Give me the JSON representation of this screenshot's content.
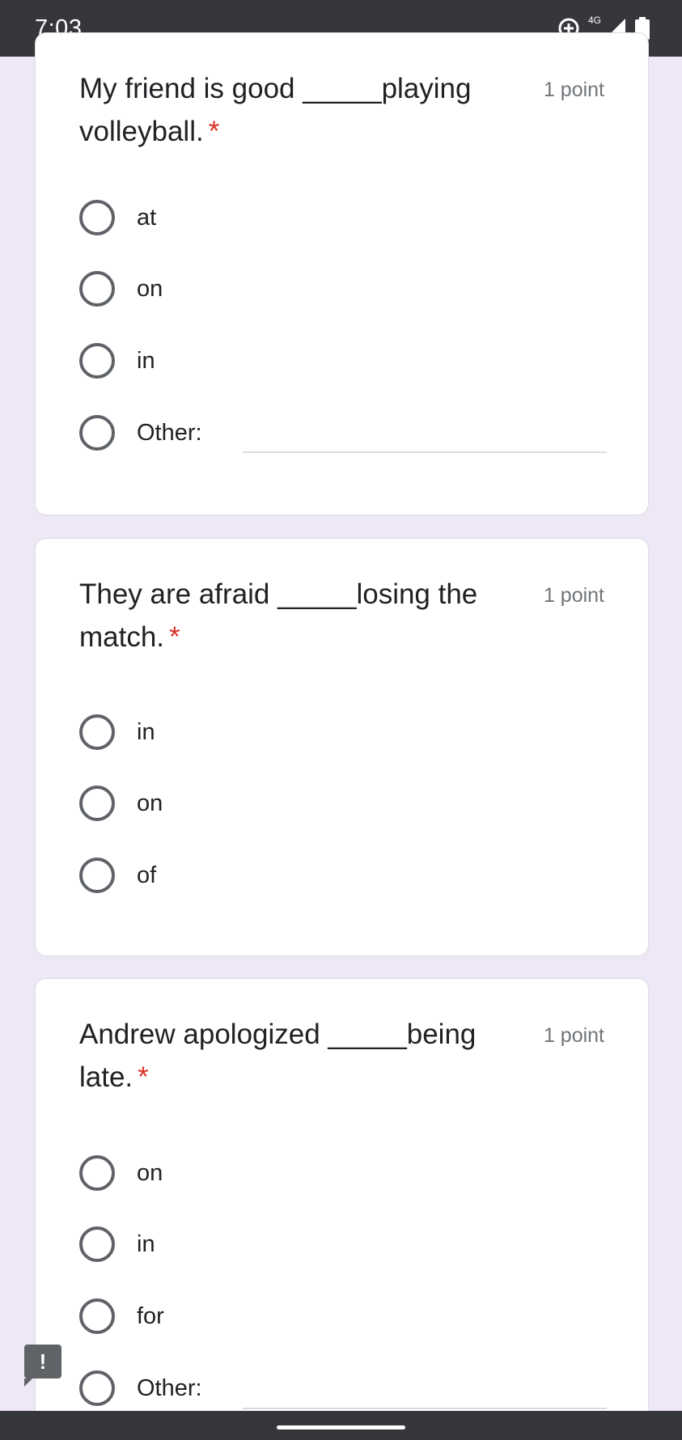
{
  "status_bar": {
    "time": "7:03",
    "network": "4G",
    "icons": [
      "data-saver-icon",
      "signal-icon",
      "battery-icon"
    ]
  },
  "questions": [
    {
      "title": "My friend is good _____playing volleyball.",
      "required_mark": "*",
      "points": "1 point",
      "options": [
        "at",
        "on",
        "in",
        "Other:"
      ]
    },
    {
      "title": "They are afraid _____losing the match.",
      "required_mark": "*",
      "points": "1 point",
      "options": [
        "in",
        "on",
        "of"
      ]
    },
    {
      "title": "Andrew apologized _____being late.",
      "required_mark": "*",
      "points": "1 point",
      "options": [
        "on",
        "in",
        "for",
        "Other:"
      ]
    }
  ],
  "feedback": {
    "icon": "feedback-icon",
    "glyph": "!"
  },
  "colors": {
    "background": "#ede7f6",
    "status_bar": "#36373b",
    "required": "#d93025",
    "radio_border": "#5f6368"
  }
}
